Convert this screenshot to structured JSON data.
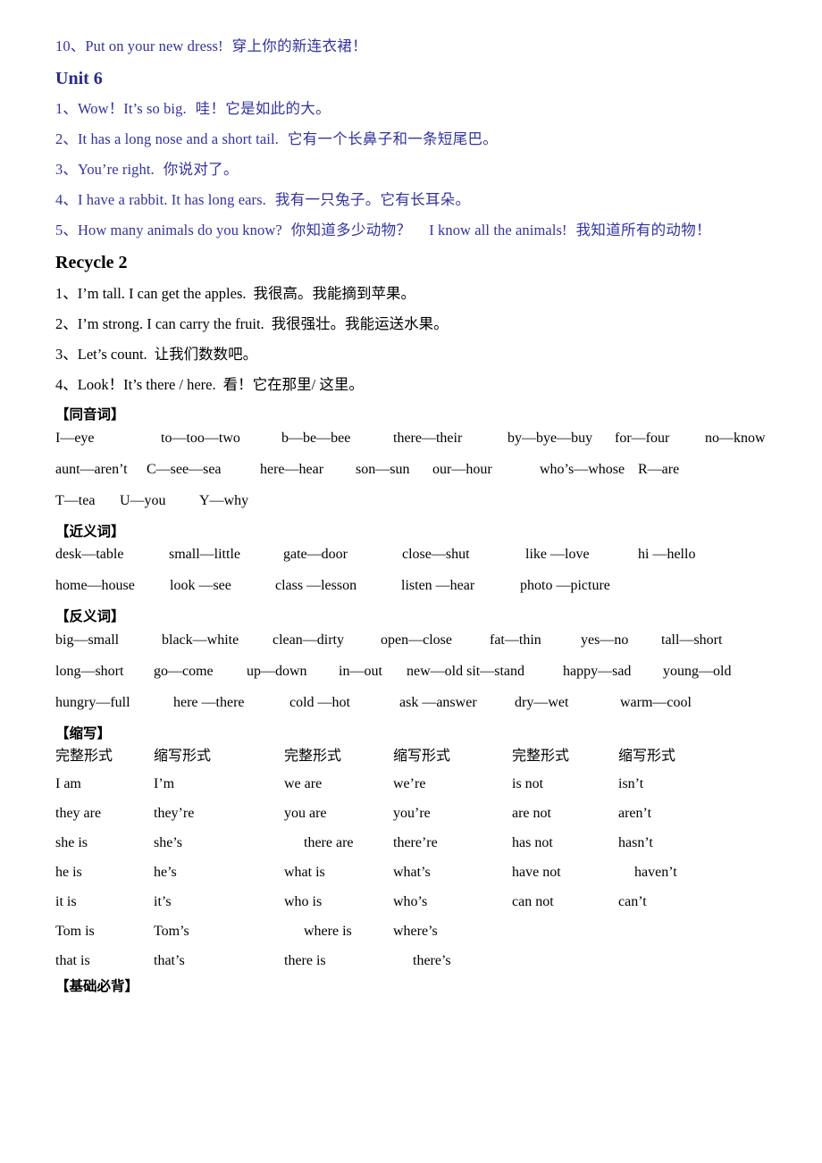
{
  "top_line": {
    "num": "10、",
    "en": "Put on your new dress!",
    "cn": "穿上你的新连衣裙！"
  },
  "unit6": {
    "heading": "Unit 6",
    "lines": [
      {
        "num": "1、",
        "en": "Wow！It’s so big.",
        "cn": "哇！它是如此的大。"
      },
      {
        "num": "2、",
        "en": "It has a long nose and a short tail.",
        "cn": "它有一个长鼻子和一条短尾巴。"
      },
      {
        "num": "3、",
        "en": "You’re right.",
        "cn": "你说对了。"
      },
      {
        "num": "4、",
        "en": "I have a rabbit. It has long ears.",
        "cn": "我有一只兔子。它有长耳朵。"
      },
      {
        "num": "5、",
        "en": "How many animals do you know?",
        "cn": "你知道多少动物？",
        "en2": "I know all the animals!",
        "cn2": "我知道所有的动物！"
      }
    ]
  },
  "recycle2": {
    "heading": "Recycle 2",
    "lines": [
      {
        "num": "1、",
        "en": "I’m tall. I can get the apples.",
        "cn": "我很高。我能摘到苹果。"
      },
      {
        "num": "2、",
        "en": "I’m strong. I can carry the fruit.",
        "cn": "我很强壮。我能运送水果。"
      },
      {
        "num": "3、",
        "en": "Let’s count.",
        "cn": "让我们数数吧。"
      },
      {
        "num": "4、",
        "en": "Look！It’s there / here.",
        "cn": "看！它在那里/ 这里。"
      }
    ]
  },
  "homophones": {
    "label": "【同音词】",
    "rows": [
      [
        "I—eye",
        "to—too—two",
        "b—be—bee",
        "there—their",
        "by—bye—buy",
        "for—four",
        "no—know"
      ],
      [
        "aunt—aren’t",
        "C—see—sea",
        "here—hear",
        "son—sun",
        "our—hour",
        "who’s—whose",
        "R—are"
      ],
      [
        "T—tea",
        "U—you",
        "Y—why"
      ]
    ]
  },
  "synonyms": {
    "label": "【近义词】",
    "rows": [
      [
        "desk—table",
        "small—little",
        "gate—door",
        "close—shut",
        "like —love",
        "hi —hello"
      ],
      [
        "home—house",
        "look —see",
        "class —lesson",
        "listen —hear",
        "photo —picture"
      ]
    ]
  },
  "antonyms": {
    "label": "【反义词】",
    "rows": [
      [
        "big—small",
        "black—white",
        "clean—dirty",
        "open—close",
        "fat—thin",
        "yes—no",
        "tall—short"
      ],
      [
        "long—short",
        "go—come",
        "up—down",
        "in—out",
        "new—old sit—stand",
        "happy—sad",
        "young—old"
      ],
      [
        "hungry—full",
        "here —there",
        "cold —hot",
        "ask —answer",
        "dry—wet",
        "warm—cool"
      ]
    ]
  },
  "contractions": {
    "label": "【缩写】",
    "headers": [
      "完整形式",
      "缩写形式",
      "完整形式",
      "缩写形式",
      "完整形式",
      "缩写形式"
    ],
    "rows": [
      [
        "I am",
        "I’m",
        "we are",
        "we’re",
        "is not",
        "isn’t"
      ],
      [
        "they are",
        "they’re",
        "you are",
        "you’re",
        "are not",
        "aren’t"
      ],
      [
        "she is",
        "she’s",
        "there are",
        "there’re",
        "has not",
        "hasn’t"
      ],
      [
        "he is",
        "he’s",
        "what is",
        "what’s",
        "have not",
        "haven’t"
      ],
      [
        "it is",
        "it’s",
        "who is",
        "who’s",
        "can not",
        "can’t"
      ],
      [
        "Tom is",
        "Tom’s",
        "where is",
        "where’s",
        "",
        ""
      ],
      [
        "that is",
        "that’s",
        "there is",
        "there’s",
        "",
        ""
      ]
    ]
  },
  "must_recite": {
    "label": "【基础必背】"
  }
}
